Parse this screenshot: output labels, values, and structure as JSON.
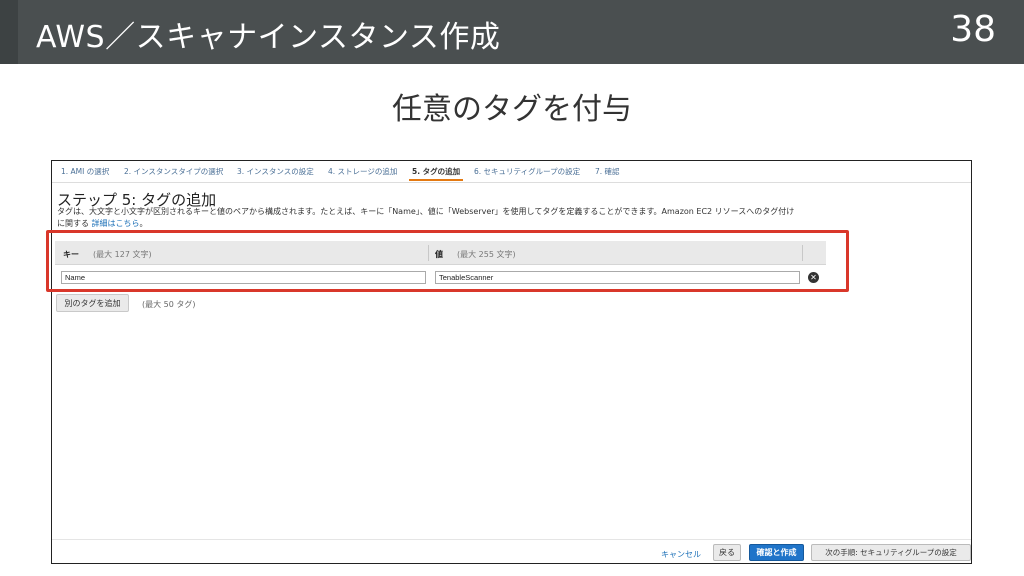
{
  "slide": {
    "title": "AWS／スキャナインスタンス作成",
    "number": "38",
    "subtitle": "任意のタグを付与"
  },
  "wizard": {
    "steps": [
      {
        "label": "1. AMI の選択",
        "active": false
      },
      {
        "label": "2. インスタンスタイプの選択",
        "active": false
      },
      {
        "label": "3. インスタンスの設定",
        "active": false
      },
      {
        "label": "4. ストレージの追加",
        "active": false
      },
      {
        "label": "5. タグの追加",
        "active": true
      },
      {
        "label": "6. セキュリティグループの設定",
        "active": false
      },
      {
        "label": "7. 確認",
        "active": false
      }
    ],
    "heading": "ステップ 5: タグの追加",
    "description_line1": "タグは、大文字と小文字が区別されるキーと値のペアから構成されます。たとえば、キーに「Name」、値に「Webserver」を使用してタグを定義することができます。Amazon EC2 リソースへのタグ付け",
    "description_line2_prefix": "に関する",
    "learn_more_label": "詳細はこちら",
    "description_line2_suffix": "。"
  },
  "tags": {
    "key_header": "キー",
    "key_limit": "(最大 127 文字)",
    "value_header": "値",
    "value_limit": "(最大 255 文字)",
    "rows": [
      {
        "key": "Name",
        "value": "TenableScanner"
      }
    ],
    "remove_icon": "✕",
    "add_button_label": "別のタグを追加",
    "max_note": "(最大 50 タグ)"
  },
  "footer": {
    "cancel_label": "キャンセル",
    "back_label": "戻る",
    "review_label": "確認と作成",
    "next_label": "次の手順: セキュリティグループの設定"
  },
  "colors": {
    "header_bg": "#4a4f50",
    "highlight": "#d9372a",
    "primary_button": "#1f74c9",
    "active_step_underline": "#e47911",
    "link": "#1a6fb7"
  }
}
